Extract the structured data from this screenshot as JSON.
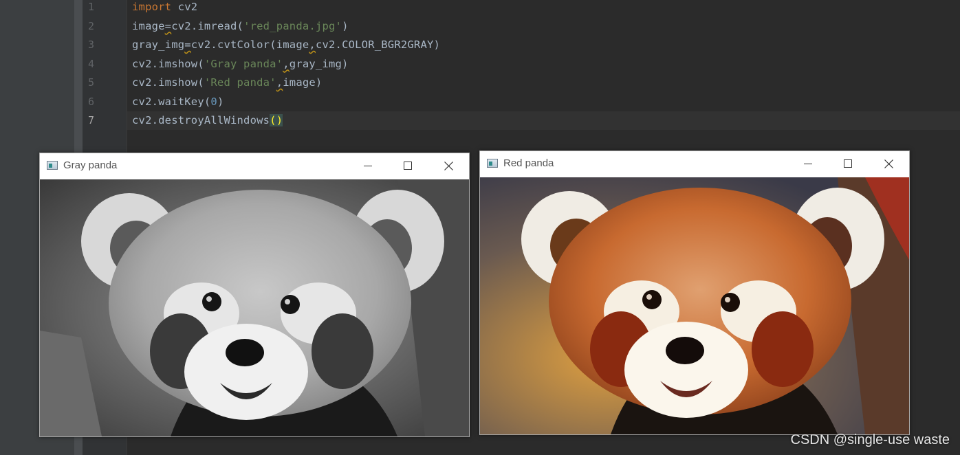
{
  "editor": {
    "lines": [
      {
        "num": "1",
        "tokens": [
          {
            "t": "import",
            "c": "kw"
          },
          {
            "t": " cv2",
            "c": ""
          }
        ]
      },
      {
        "num": "2",
        "tokens": [
          {
            "t": "image",
            "c": ""
          },
          {
            "t": "=",
            "c": "warn"
          },
          {
            "t": "cv2.imread(",
            "c": ""
          },
          {
            "t": "'red_panda.jpg'",
            "c": "str"
          },
          {
            "t": ")",
            "c": ""
          }
        ]
      },
      {
        "num": "3",
        "tokens": [
          {
            "t": "gray_img",
            "c": ""
          },
          {
            "t": "=",
            "c": "warn"
          },
          {
            "t": "cv2.cvtColor(image",
            "c": ""
          },
          {
            "t": ",",
            "c": "warn"
          },
          {
            "t": "cv2.COLOR_BGR2GRAY)",
            "c": ""
          }
        ]
      },
      {
        "num": "4",
        "tokens": [
          {
            "t": "cv2.imshow(",
            "c": ""
          },
          {
            "t": "'Gray panda'",
            "c": "str"
          },
          {
            "t": ",",
            "c": "warn"
          },
          {
            "t": "gray_img)",
            "c": ""
          }
        ]
      },
      {
        "num": "5",
        "tokens": [
          {
            "t": "cv2.imshow(",
            "c": ""
          },
          {
            "t": "'Red panda'",
            "c": "str"
          },
          {
            "t": ",",
            "c": "warn"
          },
          {
            "t": "image)",
            "c": ""
          }
        ]
      },
      {
        "num": "6",
        "tokens": [
          {
            "t": "cv2.waitKey(",
            "c": ""
          },
          {
            "t": "0",
            "c": "num"
          },
          {
            "t": ")",
            "c": ""
          }
        ]
      },
      {
        "num": "7",
        "tokens": [
          {
            "t": "cv2.destroyAllWindows",
            "c": ""
          },
          {
            "t": "()",
            "c": "paren-hl"
          }
        ]
      }
    ],
    "current_line": 7
  },
  "windows": {
    "gray": {
      "title": "Gray panda"
    },
    "red": {
      "title": "Red panda"
    }
  },
  "watermark": "CSDN @single-use waste",
  "colors": {
    "editor_bg": "#2b2b2b",
    "keyword": "#cc7832",
    "string": "#6a8759",
    "number": "#6897bb",
    "text": "#a9b7c6"
  }
}
